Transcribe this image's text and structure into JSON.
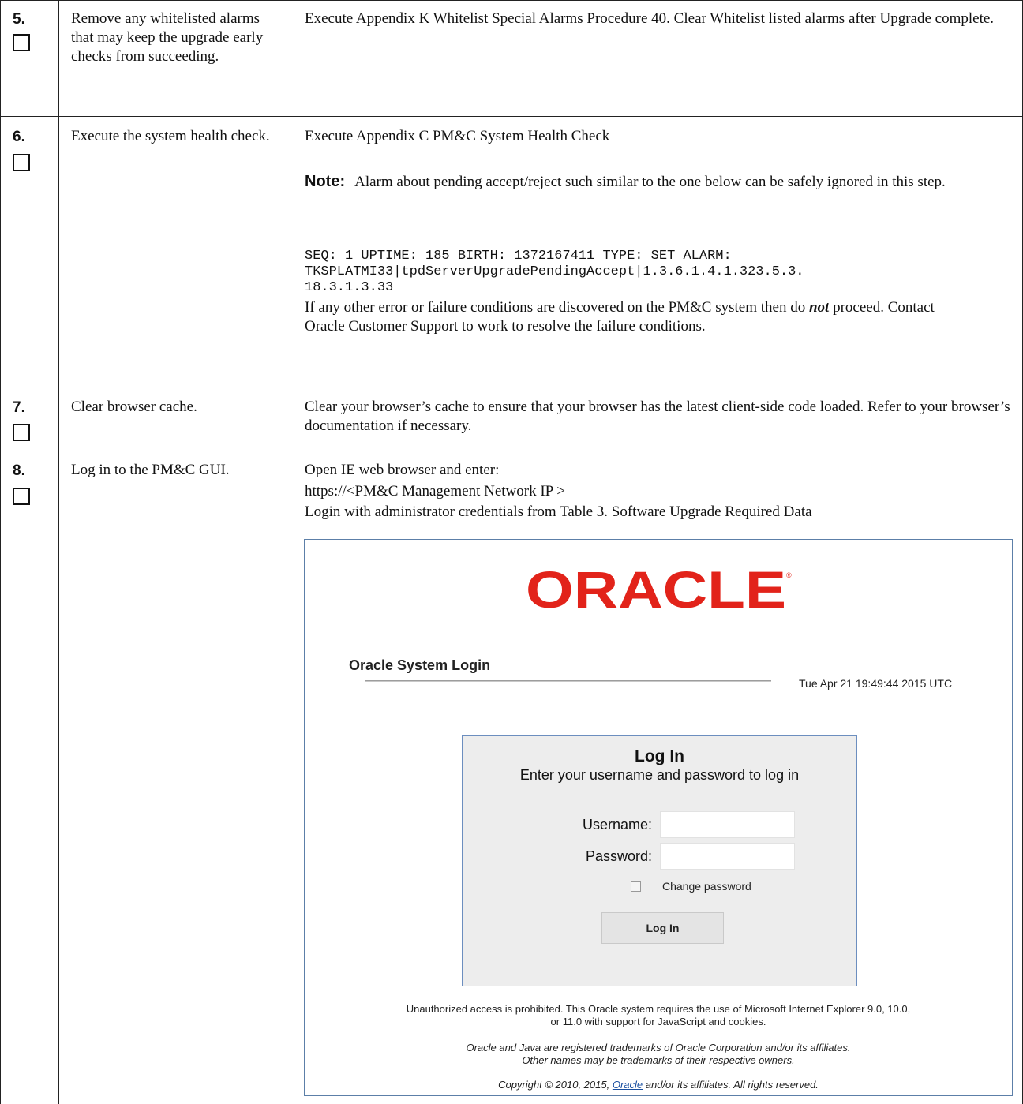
{
  "steps": [
    {
      "number": "5.",
      "action": "Remove any whitelisted alarms that may keep the upgrade early checks from succeeding.",
      "description": "Execute Appendix K Whitelist Special Alarms Procedure 40. Clear Whitelist listed alarms after Upgrade complete."
    },
    {
      "number": "6.",
      "action": "Execute the system health check.",
      "description": "Execute Appendix C PM&C System Health Check",
      "note_label": "Note:",
      "note_text": "Alarm about pending accept/reject such similar to the one below can be safely ignored in this step.",
      "code_lines": [
        "SEQ: 1 UPTIME: 185 BIRTH: 1372167411 TYPE: SET ALARM:",
        "TKSPLATMI33|tpdServerUpgradePendingAccept|1.3.6.1.4.1.323.5.3.",
        "18.3.1.3.33"
      ],
      "warning_pre": "If any other error or failure conditions are discovered on the PM&C system then do",
      "warning_emph": "not",
      "warning_post": "proceed. Contact Oracle Customer Support to work to resolve the failure conditions."
    },
    {
      "number": "7.",
      "action": "Clear browser cache.",
      "description": "Clear your browser’s cache to ensure that your browser has the latest client-side code loaded. Refer to your browser’s documentation if necessary."
    },
    {
      "number": "8.",
      "action": "Log in to the PM&C GUI.",
      "line1": "Open IE web browser and enter:",
      "line2": "https://<PM&C Management Network IP >",
      "line3": "Login with administrator credentials from Table 3. Software Upgrade Required Data"
    }
  ],
  "login_screen": {
    "logo_text": "ORACLE",
    "brand_color": "#e2231a",
    "system_title": "Oracle System Login",
    "timestamp": "Tue Apr 21 19:49:44 2015 UTC",
    "box_title": "Log In",
    "box_subtitle": "Enter your username and password to log in",
    "username_label": "Username:",
    "username_value": "",
    "password_label": "Password:",
    "password_value": "",
    "change_password_label": "Change password",
    "change_password_checked": false,
    "login_button": "Log In",
    "warning_line1": "Unauthorized access is prohibited. This Oracle system requires the use of Microsoft Internet Explorer 9.0, 10.0,",
    "warning_line2": "or 11.0 with support for JavaScript and cookies.",
    "trademark_line1": "Oracle and Java are registered trademarks of Oracle Corporation and/or its affiliates.",
    "trademark_line2": "Other names may be trademarks of their respective owners.",
    "copyright_pre": "Copyright © 2010, 2015,",
    "copyright_link": "Oracle",
    "copyright_post": "and/or its affiliates. All rights reserved."
  }
}
